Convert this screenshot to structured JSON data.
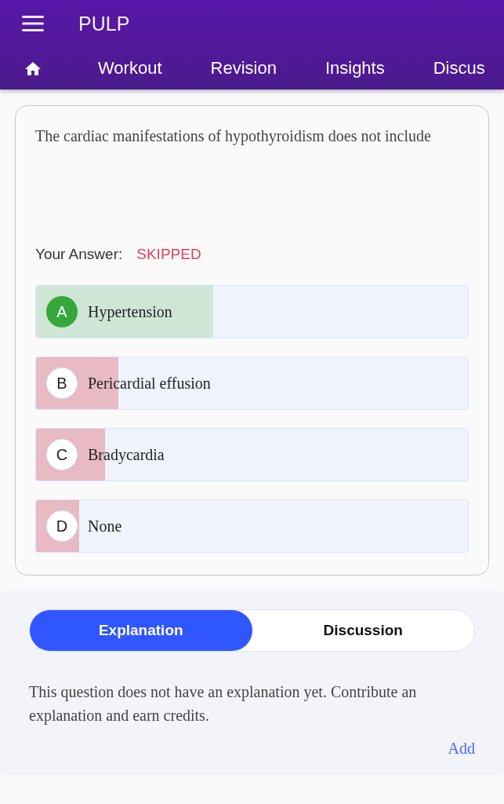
{
  "header": {
    "title": "PULP",
    "nav": [
      "Workout",
      "Revision",
      "Insights",
      "Discus"
    ]
  },
  "question": {
    "text": "The cardiac manifestations of hypothyroidism does not include",
    "answer_label": "Your Answer:",
    "answer": "SKIPPED",
    "options": [
      {
        "letter": "A",
        "text": "Hypertension",
        "correct": true,
        "level": 0.41
      },
      {
        "letter": "B",
        "text": "Pericardial effusion",
        "correct": false,
        "level": 0.19
      },
      {
        "letter": "C",
        "text": "Bradycardia",
        "correct": false,
        "level": 0.16
      },
      {
        "letter": "D",
        "text": "None",
        "correct": false,
        "level": 0.1
      }
    ]
  },
  "explanation_panel": {
    "tabs": [
      {
        "label": "Explanation",
        "selected": true
      },
      {
        "label": "Discussion",
        "selected": false
      }
    ],
    "text": "This question does not have an explanation yet. Contribute an explanation and earn credits.",
    "action": "Add"
  }
}
